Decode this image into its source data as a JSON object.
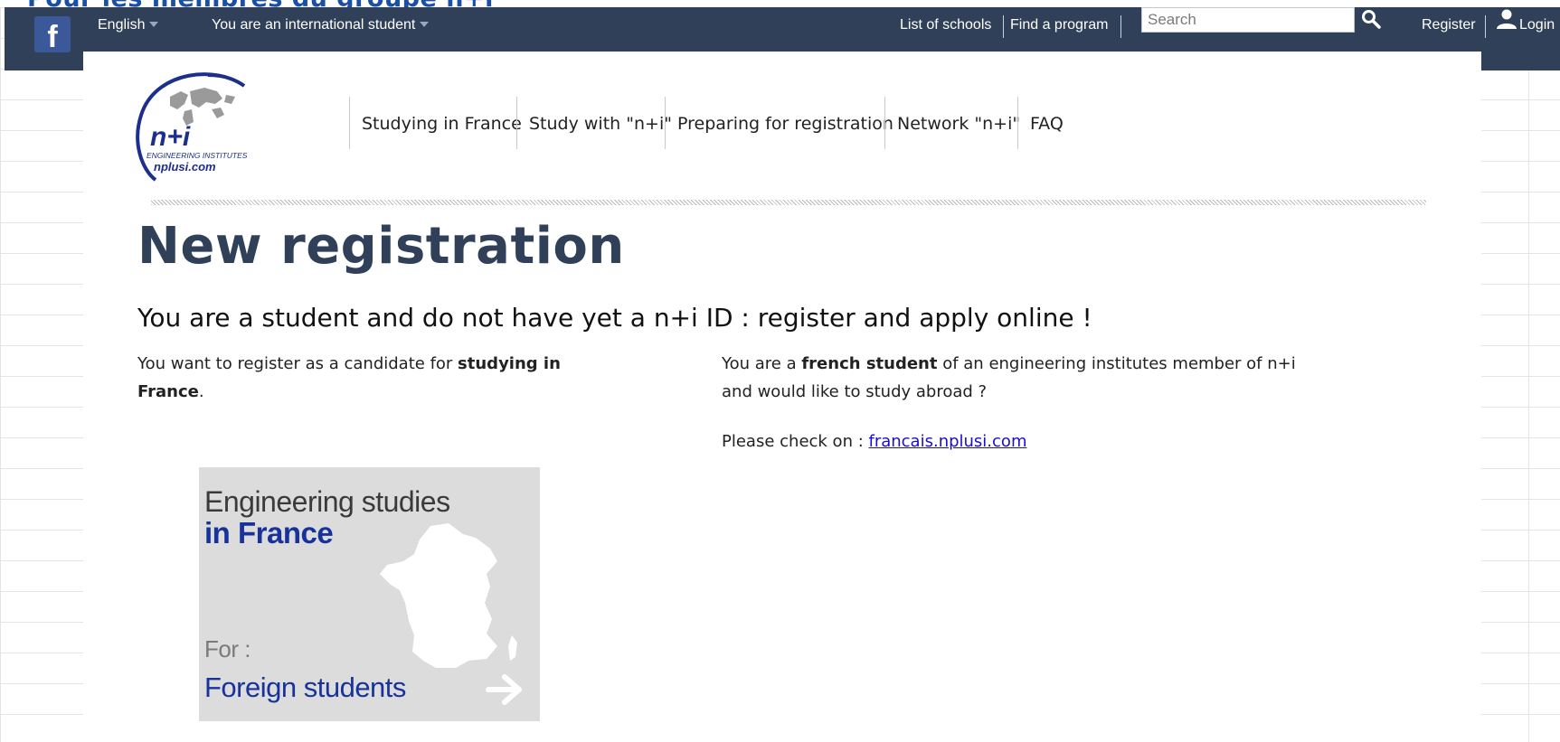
{
  "top_strip": {
    "clipped_heading": "Pour les membres du groupe n+i"
  },
  "topbar": {
    "facebook_glyph": "f",
    "language": "English",
    "profile": "You are an international student",
    "list_of_schools": "List of schools",
    "find_program": "Find a program",
    "search_placeholder": "Search",
    "register": "Register",
    "login": "Login"
  },
  "logo": {
    "text": "n+i",
    "tagline": "ENGINEERING INSTITUTES",
    "url": "nplusi.com"
  },
  "nav": [
    {
      "label": "Studying in France"
    },
    {
      "label": "Study with \"n+i\""
    },
    {
      "label": "Preparing for registration"
    },
    {
      "label": "Network \"n+i\""
    },
    {
      "label": "FAQ"
    }
  ],
  "page": {
    "title": "New registration",
    "subtitle": "You are a student and do not have yet a n+i ID : register and apply online !"
  },
  "left_col": {
    "text_pre": "You want to register as a candidate for ",
    "text_bold": "studying in France",
    "text_post": "."
  },
  "right_col": {
    "line_pre": "You are a ",
    "line_bold": "french student",
    "line_post": " of an engineering institutes member of n+i and would like to study abroad ?",
    "check_label": "Please check on : ",
    "check_link": "francais.nplusi.com"
  },
  "banner": {
    "line1": "Engineering studies",
    "line2": "in France",
    "for_label": "For :",
    "audience": "Foreign students"
  },
  "colors": {
    "topbar_bg": "#2f4058",
    "title": "#2f4058",
    "banner_blue": "#17339b",
    "link": "#1a0dcd",
    "facebook": "#3b5998"
  }
}
